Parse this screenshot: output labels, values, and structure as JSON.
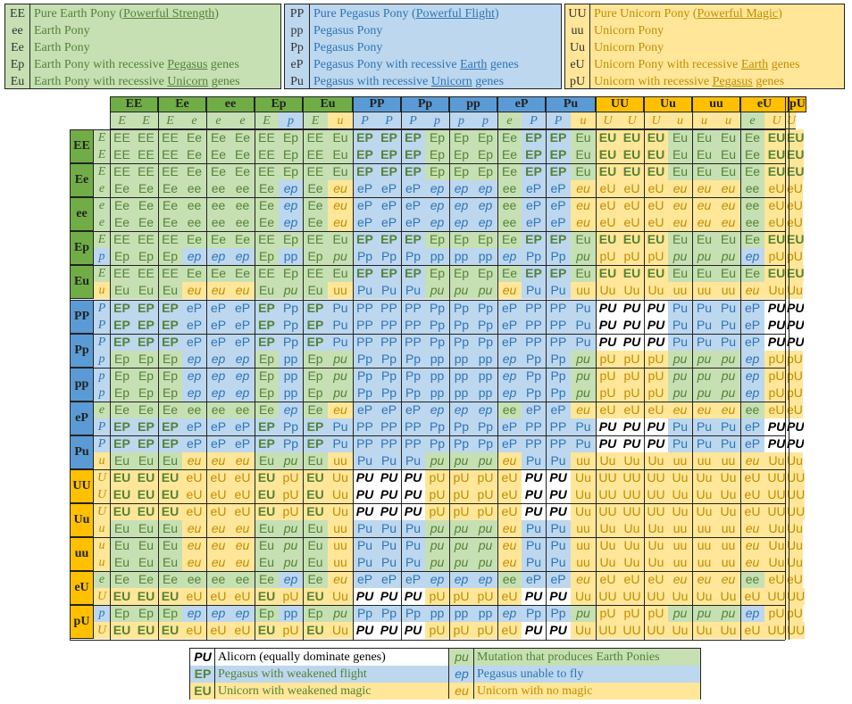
{
  "colors": {
    "E": "#c6e0b4",
    "P": "#bdd7ee",
    "U": "#ffe699",
    "hdrE": "#70ad47",
    "hdrP": "#5b9bd5",
    "hdrU": "#ffc000",
    "txtE": "#548235",
    "txtP": "#2e75b6",
    "txtU": "#bf8f00",
    "white": "#ffffff"
  },
  "top_legend": [
    {
      "group": "E",
      "rows": [
        {
          "code": "EE",
          "pre": "Pure Earth Pony (",
          "link": "Powerful Strength",
          "post": ")"
        },
        {
          "code": "ee",
          "pre": "Earth Pony",
          "link": "",
          "post": ""
        },
        {
          "code": "Ee",
          "pre": "Earth Pony",
          "link": "",
          "post": ""
        },
        {
          "code": "Ep",
          "pre": "Earth Pony with recessive ",
          "link": "Pegasus",
          "post": " genes"
        },
        {
          "code": "Eu",
          "pre": "Earth Pony with recessive ",
          "link": "Unicorn",
          "post": " genes"
        }
      ]
    },
    {
      "group": "P",
      "rows": [
        {
          "code": "PP",
          "pre": "Pure Pegasus Pony (",
          "link": "Powerful Flight",
          "post": ")"
        },
        {
          "code": "pp",
          "pre": "Pegasus Pony",
          "link": "",
          "post": ""
        },
        {
          "code": "Pp",
          "pre": "Pegasus Pony",
          "link": "",
          "post": ""
        },
        {
          "code": "eP",
          "pre": "Pegasus Pony with recessive ",
          "link": "Earth",
          "post": " genes"
        },
        {
          "code": "Pu",
          "pre": "Pegasus with recessive ",
          "link": "Unicorn",
          "post": " genes"
        }
      ]
    },
    {
      "group": "U",
      "rows": [
        {
          "code": "UU",
          "pre": "Pure Unicorn Pony (",
          "link": "Powerful Magic",
          "post": ")"
        },
        {
          "code": "uu",
          "pre": "Unicorn Pony",
          "link": "",
          "post": ""
        },
        {
          "code": "Uu",
          "pre": "Unicorn Pony",
          "link": "",
          "post": ""
        },
        {
          "code": "eU",
          "pre": "Unicorn Pony with recessive ",
          "link": "Earth",
          "post": " genes"
        },
        {
          "code": "pU",
          "pre": "Unicorn with recessive ",
          "link": "Pegasus",
          "post": " genes"
        }
      ]
    }
  ],
  "grid": {
    "parents": [
      "EE",
      "Ee",
      "ee",
      "Ep",
      "Eu",
      "PP",
      "Pp",
      "pp",
      "eP",
      "Pu",
      "UU",
      "Uu",
      "uu",
      "eU",
      "pU"
    ],
    "alleles": [
      [
        "E",
        "E"
      ],
      [
        "E",
        "e"
      ],
      [
        "e",
        "e"
      ],
      [
        "E",
        "p"
      ],
      [
        "E",
        "u"
      ],
      [
        "P",
        "P"
      ],
      [
        "P",
        "p"
      ],
      [
        "p",
        "p"
      ],
      [
        "e",
        "P"
      ],
      [
        "P",
        "u"
      ],
      [
        "U",
        "U"
      ],
      [
        "U",
        "u"
      ],
      [
        "u",
        "u"
      ],
      [
        "e",
        "U"
      ],
      [
        "p",
        "U"
      ]
    ],
    "rules": [
      [
        "EE",
        "Ee",
        "Ee",
        "Ep",
        "Eu"
      ],
      [
        "Ee",
        "ee",
        "ee",
        "ep",
        "eu"
      ],
      [
        "Ee",
        "ee",
        "ee",
        "ep",
        "eu"
      ],
      [
        "Ep",
        "ep",
        "ep",
        "pp",
        "pu"
      ],
      [
        "Eu",
        "eu",
        "eu",
        "pu",
        "uu"
      ]
    ],
    "cells": [
      [
        "EE",
        "EE",
        "EE",
        "Ee",
        "Ee",
        "Ee",
        "Ee",
        "EE",
        "Ep",
        "EE",
        "Eu",
        "EP",
        "EP",
        "EP",
        "Ep",
        "Ep",
        "Ep",
        "Ee",
        "EP",
        "EP",
        "Eu",
        "EU",
        "EU",
        "EU",
        "Eu",
        "Eu",
        "Eu",
        "Ee",
        "EU",
        "Ep",
        "EU"
      ],
      [
        "EE",
        "EE",
        "EE",
        "Ee",
        "Ee",
        "Ee",
        "Ee",
        "EE",
        "Ep",
        "EE",
        "Eu",
        "EP",
        "EP",
        "EP",
        "Ep",
        "Ep",
        "Ep",
        "Ee",
        "EP",
        "EP",
        "Eu",
        "EU",
        "EU",
        "EU",
        "Eu",
        "Eu",
        "Eu",
        "Ee",
        "EU",
        "Ep",
        "EU"
      ],
      [
        "EE",
        "EE",
        "EE",
        "Ee",
        "Ee",
        "Ee",
        "Ee",
        "EE",
        "Ep",
        "EE",
        "Eu",
        "EP",
        "EP",
        "EP",
        "Ep",
        "Ep",
        "Ep",
        "Ee",
        "EP",
        "EP",
        "Eu",
        "EU",
        "EU",
        "EU",
        "Eu",
        "Eu",
        "Eu",
        "Ee",
        "EU",
        "Ep",
        "EU"
      ],
      [
        "Ee",
        "Ee",
        "Ee",
        "ee",
        "ee",
        "ee",
        "ee",
        "Ee",
        "ep",
        "Ee",
        "eu",
        "eP",
        "eP",
        "eP",
        "ep",
        "ep",
        "ep",
        "ee",
        "eP",
        "eP",
        "eu",
        "eU",
        "eU",
        "eU",
        "eu",
        "eu",
        "eu",
        "ee",
        "eU",
        "ep",
        "eU"
      ],
      [
        "Ee",
        "Ee",
        "Ee",
        "ee",
        "ee",
        "ee",
        "ee",
        "Ee",
        "ep",
        "Ee",
        "eu",
        "eP",
        "eP",
        "eP",
        "ep",
        "ep",
        "ep",
        "ee",
        "eP",
        "eP",
        "eu",
        "eU",
        "eU",
        "eU",
        "eu",
        "eu",
        "eu",
        "ee",
        "eU",
        "ep",
        "eU"
      ],
      [
        "Ee",
        "Ee",
        "Ee",
        "ee",
        "ee",
        "ee",
        "ee",
        "Ee",
        "ep",
        "Ee",
        "eu",
        "eP",
        "eP",
        "eP",
        "ep",
        "ep",
        "ep",
        "ee",
        "eP",
        "eP",
        "eu",
        "eU",
        "eU",
        "eU",
        "eu",
        "eu",
        "eu",
        "ee",
        "eU",
        "ep",
        "eU"
      ],
      [
        "EE",
        "EE",
        "EE",
        "Ee",
        "Ee",
        "Ee",
        "Ee",
        "EE",
        "Ep",
        "EE",
        "Eu",
        "EP",
        "EP",
        "EP",
        "Ep",
        "Ep",
        "Ep",
        "Ee",
        "EP",
        "EP",
        "Eu",
        "EU",
        "EU",
        "EU",
        "Eu",
        "Eu",
        "Eu",
        "Ee",
        "EU",
        "Ep",
        "EU"
      ],
      [
        "Ep",
        "EP",
        "EP",
        "ep",
        "ep",
        "ep",
        "ep",
        "Ep",
        "pp",
        "Ep",
        "pu",
        "Pp",
        "Pp",
        "Pp",
        "pp",
        "pp",
        "pp",
        "ep",
        "Pp",
        "Pp",
        "pu",
        "pU",
        "pU",
        "pU",
        "pu",
        "pu",
        "pu",
        "ep",
        "pU",
        "pp",
        "pU"
      ],
      [
        "EE",
        "EE",
        "EE",
        "Ee",
        "Ee",
        "Ee",
        "Ee",
        "EE",
        "Ep",
        "EE",
        "Eu",
        "EP",
        "EP",
        "EP",
        "Ep",
        "Ep",
        "Ep",
        "Ee",
        "EP",
        "EP",
        "Eu",
        "EU",
        "EU",
        "EU",
        "Eu",
        "Eu",
        "Eu",
        "Ee",
        "EU",
        "Ep",
        "EU"
      ],
      [
        "Eu",
        "Eu",
        "Eu",
        "eu",
        "eu",
        "eu",
        "eu",
        "Eu",
        "pu",
        "Eu",
        "uu",
        "Pu",
        "Pu",
        "Pu",
        "pu",
        "pu",
        "pu",
        "eu",
        "Pu",
        "Pu",
        "uu",
        "Uu",
        "Uu",
        "Uu",
        "uu",
        "uu",
        "uu",
        "eu",
        "Uu",
        "pu",
        "Uu"
      ]
    ]
  },
  "bottom_legend": {
    "left": [
      {
        "code": "PU",
        "text": "Alicorn (equally dominate genes)"
      },
      {
        "code": "EP",
        "text": "Pegasus with weakened flight"
      },
      {
        "code": "EU",
        "text": "Unicorn with weakened magic"
      }
    ],
    "right": [
      {
        "code": "pu",
        "text": "Mutation that produces Earth Ponies"
      },
      {
        "code": "ep",
        "text": "Pegasus unable to fly"
      },
      {
        "code": "eu",
        "text": "Unicorn with no magic"
      }
    ]
  }
}
